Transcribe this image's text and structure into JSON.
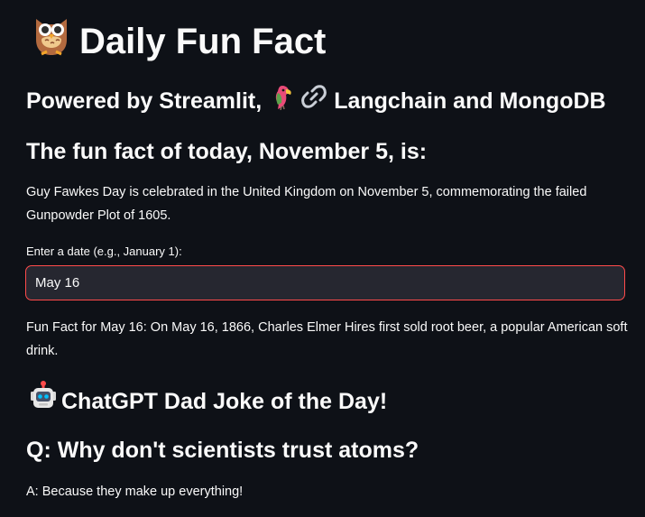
{
  "app": {
    "title": "Daily Fun Fact",
    "title_icon": "owl-icon",
    "subtitle_prefix": "Powered by Streamlit,",
    "subtitle_langchain": "Langchain and MongoDB",
    "parrot_icon": "parrot-icon",
    "link_icon": "link-icon"
  },
  "fact": {
    "heading": "The fun fact of today, November 5, is:",
    "text": "Guy Fawkes Day is celebrated in the United Kingdom on November 5, commemorating the failed Gunpowder Plot of 1605."
  },
  "date_input": {
    "label": "Enter a date (e.g., January 1):",
    "value": "May 16",
    "border_color": "#ff4b4b"
  },
  "result": {
    "text": "Fun Fact for May 16: On May 16, 1866, Charles Elmer Hires first sold root beer, a popular American soft drink."
  },
  "joke": {
    "heading": "ChatGPT Dad Joke of the Day!",
    "heading_icon": "robot-icon",
    "question": "Q: Why don't scientists trust atoms?",
    "answer": "A: Because they make up everything!"
  },
  "colors": {
    "background": "#0e1117",
    "text": "#fafafa",
    "input_background": "#262730",
    "accent": "#ff4b4b"
  }
}
